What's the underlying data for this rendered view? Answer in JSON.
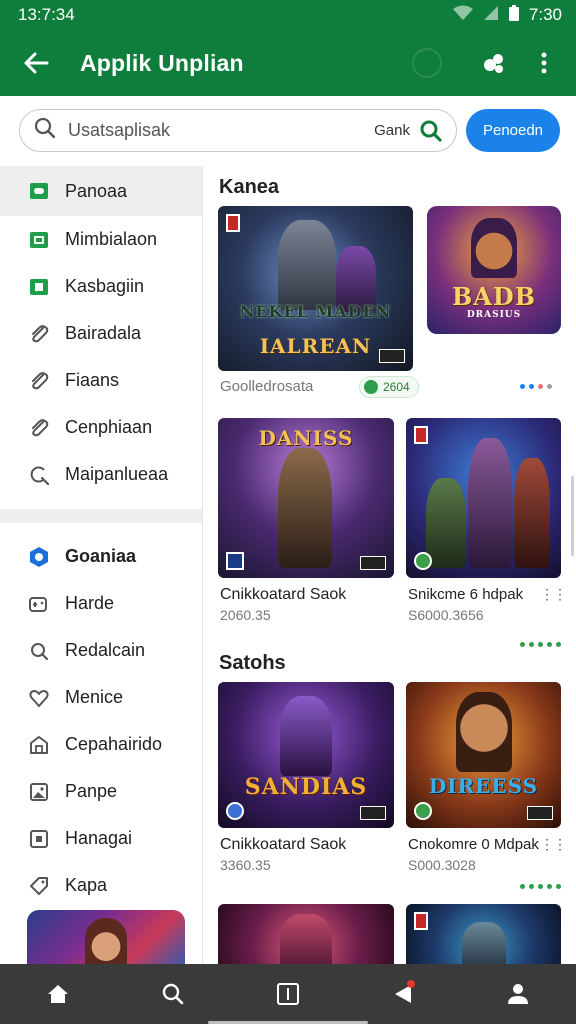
{
  "status_bar": {
    "time": "13:7:34",
    "right_time": "7:30",
    "icons": [
      "wifi-icon",
      "signal-icon",
      "battery-icon"
    ]
  },
  "app_bar": {
    "title": "Applik Unplian",
    "icons": [
      "back-arrow-icon",
      "profile-link-icon",
      "more-vert-icon"
    ]
  },
  "search": {
    "placeholder": "Usatsaplisak",
    "mode_label": "Gank",
    "button_label": "Penoedn"
  },
  "sidebar": {
    "items": [
      {
        "label": "Panoaa",
        "icon": "square-badge-icon"
      },
      {
        "label": "Mimbialaon",
        "icon": "square-badge-icon"
      },
      {
        "label": "Kasbagiin",
        "icon": "square-badge-icon"
      },
      {
        "label": "Bairadala",
        "icon": "paperclip-icon"
      },
      {
        "label": "Fiaans",
        "icon": "paperclip-icon"
      },
      {
        "label": "Cenphiaan",
        "icon": "paperclip-icon"
      },
      {
        "label": "Maipanlueaa",
        "icon": "search-refresh-icon"
      }
    ],
    "section": {
      "label": "Goaniaa",
      "icon": "hexagon-icon"
    },
    "section_items": [
      {
        "label": "Harde",
        "icon": "gamepad-icon"
      },
      {
        "label": "Redalcain",
        "icon": "search-icon"
      },
      {
        "label": "Menice",
        "icon": "heart-icon"
      },
      {
        "label": "Cepahairido",
        "icon": "house-icon"
      },
      {
        "label": "Panpe",
        "icon": "image-icon"
      },
      {
        "label": "Hanagai",
        "icon": "square-icon"
      },
      {
        "label": "Kapa",
        "icon": "tag-icon"
      }
    ]
  },
  "sections": [
    {
      "title": "Kanea",
      "featured": {
        "art_title": "NEKEL MADEN",
        "art_sub": "IALREAN",
        "caption": "Goolledrosata",
        "pill": "2604"
      },
      "side_art": {
        "art_title": "BADB",
        "art_sub": "DRASIUS"
      },
      "cards": [
        {
          "art_title": "DANISS",
          "caption": "Cnikkoatard Saok",
          "sub": "2060.35"
        },
        {
          "art_title": "",
          "caption": "Snikcme 6 hdpak",
          "sub": "S6000.3656"
        }
      ]
    },
    {
      "title": "Satohs",
      "cards": [
        {
          "art_title": "SANDIAS",
          "caption": "Cnikkoatard Saok",
          "sub": "3360.35"
        },
        {
          "art_title": "DIREESS",
          "caption": "Cnokomre 0 Mdpak",
          "sub": "S000.3028"
        }
      ]
    }
  ],
  "bottom_nav": [
    "home-icon",
    "search-icon",
    "square-icon",
    "back-icon",
    "person-icon"
  ],
  "colors": {
    "primary": "#0f7d3b",
    "accent_blue": "#1a82e8",
    "nav_bg": "#3a3a3a"
  }
}
